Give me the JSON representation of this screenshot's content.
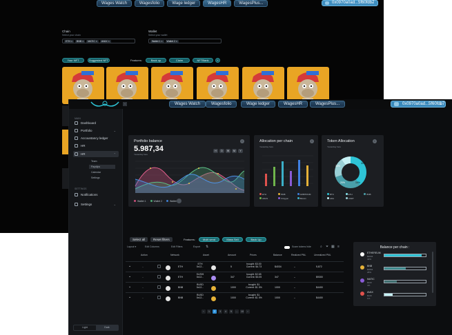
{
  "back": {
    "nav": [
      "Wages Watch",
      "Wagesfolio",
      "Wage ledger",
      "WagesHR",
      "WagesPlus..."
    ],
    "wallet": "0x0970a0ad...5f60fdb7",
    "filters": {
      "chain": {
        "label": "Chain",
        "sub": "Select your chain",
        "chips": [
          "ETH ×",
          "BNB ×",
          "MATIC ×",
          "AVAX ×"
        ]
      },
      "wallet": {
        "label": "Wallet",
        "sub": "Select your wallet",
        "chips": [
          "Wallet 1 ×",
          "Wallet 2 ×"
        ]
      }
    },
    "buttons": {
      "your_nft": "Your NFT",
      "suggested_nft": "Suggested NFT",
      "features": "Features:",
      "back_up": "Back up",
      "claim": "Claim",
      "nft_bank": "NFTBank",
      "plus": "+"
    },
    "stubs": [
      "Produ",
      "Wallet",
      "Asse",
      "Brows",
      "Walle",
      "Asse"
    ]
  },
  "front": {
    "nav": [
      "Wages Watch",
      "Wagesfolio",
      "Wage ledger",
      "WagesHR",
      "WagesPlus..."
    ],
    "wallet": "0x0970a0ad...5f60fdb7",
    "sidebar": {
      "section_main": "MAIN",
      "items": [
        "Dashboard",
        "Portfolio",
        "Accountancy ledger",
        "HR",
        "HR"
      ],
      "sub": [
        "Team",
        "Payslips",
        "Calendar",
        "Settings"
      ],
      "section_settings": "SETTINGS",
      "bottom_items": [
        "Notifications",
        "Settings"
      ],
      "theme": {
        "light": "Light",
        "dark": "Dark"
      }
    },
    "portfolio": {
      "title": "Portfolio balance",
      "value": "5.987,34",
      "sub": "Yesterday here",
      "periods": [
        "H",
        "D",
        "W",
        "M",
        "Y"
      ],
      "legend": [
        {
          "label": "Wallet 1",
          "color": "#c94f7a"
        },
        {
          "label": "Wallet 2",
          "color": "#4fa874"
        },
        {
          "label": "Wallet 3",
          "color": "#3e7fd1"
        }
      ]
    },
    "allocation_chain": {
      "title": "Allocation per chain",
      "sub": "Yesterday here",
      "legend": [
        {
          "label": "ETH",
          "color": "#e0524d"
        },
        {
          "label": "BNB",
          "color": "#e6b238"
        },
        {
          "label": "ARBITRUM",
          "color": "#3f7fe0"
        },
        {
          "label": "ADAS",
          "color": "#6fb54c"
        },
        {
          "label": "Polygon",
          "color": "#8a5bd6"
        },
        {
          "label": "Bitcoin",
          "color": "#3bb0c9"
        }
      ]
    },
    "token_allocation": {
      "title": "Token Allocation",
      "sub": "Yesterday here",
      "labels": [
        "10%",
        "20%",
        "30%",
        "40%"
      ],
      "legend": [
        {
          "label": "BTC",
          "color": "#2ec4d6"
        },
        {
          "label": "ETH",
          "color": "#86e3ec"
        },
        {
          "label": "BNB",
          "color": "#4aa0aa"
        },
        {
          "label": "ADA",
          "color": "#c6f1f5"
        },
        {
          "label": "USDT",
          "color": "#9ad0d6"
        }
      ]
    },
    "table_controls": {
      "select_all": "Select all",
      "reset_filters": "Reset filters",
      "features": "Features:",
      "multi_send": "Multi send",
      "mass_sell": "Mass Sell",
      "back_up": "Back Up",
      "toolbar": [
        "Layout ▾",
        "Edit Columns",
        "Edit Filters",
        "Export"
      ],
      "scam": "Scam tokens hide"
    },
    "table": {
      "headers": [
        "Action",
        "Network",
        "Asset",
        "Amount",
        "Prices",
        "Balance",
        "Realized PNL",
        "Unrealized PNL"
      ],
      "rows": [
        {
          "net": "ETH",
          "asset": "ETH 0x12...",
          "amount": "5",
          "prices": "bought: $3.00 Current: $4.73",
          "balance": "$4034",
          "realized": "–",
          "unrealized": "5,872"
        },
        {
          "net": "ETH",
          "asset": "SUSHI 0x12...",
          "amount": "347",
          "prices": "bought: $2.65 Current: $3.05",
          "balance": "347",
          "realized": "–",
          "unrealized": "$9300"
        },
        {
          "net": "BNB",
          "asset": "BUSD 0x12...",
          "amount": "1000",
          "prices": "bought: $1 Current: $1 0%",
          "balance": "1000",
          "realized": "–",
          "unrealized": "$4400"
        },
        {
          "net": "BNB",
          "asset": "BUSD 0x12...",
          "amount": "1000",
          "prices": "bought: $1 Current: $1 0%",
          "balance": "1000",
          "realized": "–",
          "unrealized": "$4400"
        }
      ],
      "pager": [
        "‹",
        "1",
        "2",
        "3",
        "4",
        "5",
        "...",
        "10",
        "›"
      ]
    },
    "balance_chain": {
      "title": "Balance per chain :",
      "rows": [
        {
          "name": "ETHEREUM",
          "val1": "$4034",
          "val2": "40%",
          "fill": 0.9,
          "color": "#2ec4d6"
        },
        {
          "name": "BNB",
          "val1": "$2834",
          "val2": "28%",
          "fill": 0.52,
          "color": "#3f8a8e"
        },
        {
          "name": "MATIC",
          "val1": "$420",
          "val2": "4%",
          "fill": 0.3,
          "color": "#3f6f70"
        },
        {
          "name": "AVAX",
          "val1": "$120",
          "val2": "1%",
          "fill": 0.2,
          "color": "#c6f4f7"
        }
      ]
    }
  }
}
